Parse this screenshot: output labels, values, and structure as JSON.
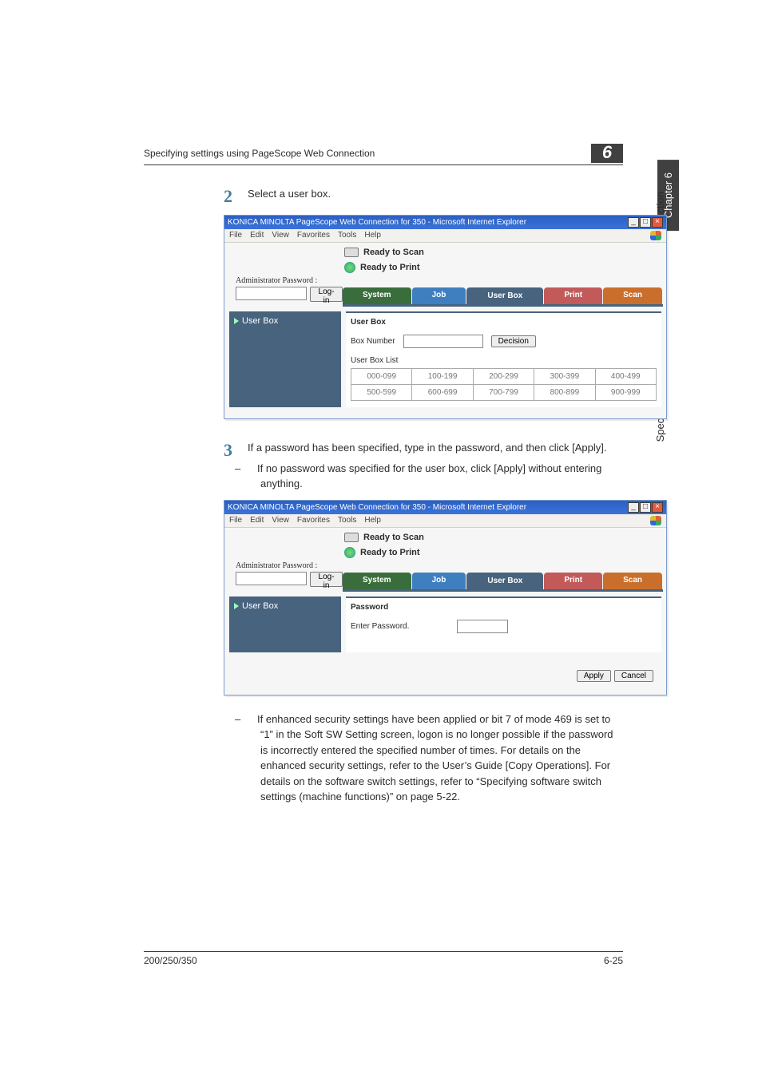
{
  "header": {
    "title_left": "Specifying settings using PageScope Web Connection",
    "chapter_num": "6"
  },
  "side": {
    "chapter_tab": "Chapter 6",
    "vertical_label": "Specifying settings using PageScope Web Connection"
  },
  "steps": {
    "s2": {
      "num": "2",
      "text": "Select a user box."
    },
    "s3": {
      "num": "3",
      "text": "If a password has been specified, type in the password, and then click [Apply].",
      "sub1": "If no password was specified for the user box, click [Apply] without entering anything.",
      "sub2": "If enhanced security settings have been applied or bit 7 of mode 469 is set to “1” in the Soft SW Setting screen, logon is no longer possible if the password is incorrectly entered the specified number of times. For details on the enhanced security settings, refer to the User’s Guide [Copy Operations]. For details on the software switch settings, refer to “Specifying software switch settings (machine functions)” on page 5-22."
    }
  },
  "screenshot": {
    "window_title": "KONICA MINOLTA PageScope Web Connection for 350 - Microsoft Internet Explorer",
    "menus": [
      "File",
      "Edit",
      "View",
      "Favorites",
      "Tools",
      "Help"
    ],
    "status_scan": "Ready to Scan",
    "status_print": "Ready to Print",
    "admin_label": "Administrator Password :",
    "login_btn": "Log-in",
    "tabs": {
      "system": "System",
      "job": "Job",
      "userbox": "User Box",
      "print": "Print",
      "scan": "Scan"
    },
    "left_userbox": "User Box",
    "ub": {
      "title": "User Box",
      "boxnum_label": "Box Number",
      "decision_btn": "Decision",
      "list_label": "User Box List",
      "ranges": [
        [
          "000-099",
          "100-199",
          "200-299",
          "300-399",
          "400-499"
        ],
        [
          "500-599",
          "600-699",
          "700-799",
          "800-899",
          "900-999"
        ]
      ]
    },
    "pw": {
      "title": "Password",
      "enter_label": "Enter Password.",
      "apply": "Apply",
      "cancel": "Cancel"
    }
  },
  "footer": {
    "left": "200/250/350",
    "right": "6-25"
  }
}
